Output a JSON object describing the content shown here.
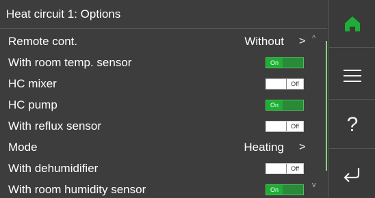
{
  "header": {
    "title": "Heat circuit 1: Options"
  },
  "rows": [
    {
      "label": "Remote cont.",
      "type": "select",
      "value": "Without"
    },
    {
      "label": "With room temp. sensor",
      "type": "toggle",
      "state": "On"
    },
    {
      "label": "HC mixer",
      "type": "toggle",
      "state": "Off"
    },
    {
      "label": "HC pump",
      "type": "toggle",
      "state": "On"
    },
    {
      "label": "With reflux sensor",
      "type": "toggle",
      "state": "Off"
    },
    {
      "label": "Mode",
      "type": "select",
      "value": "Heating"
    },
    {
      "label": "With dehumidifier",
      "type": "toggle",
      "state": "Off"
    },
    {
      "label": "With room humidity sensor",
      "type": "toggle",
      "state": "On"
    }
  ],
  "glyphs": {
    "chevron_right": ">",
    "scroll_up": "^",
    "scroll_down": "v"
  },
  "sidebar": {
    "icons": [
      "home-icon",
      "menu-icon",
      "help-icon",
      "back-icon"
    ],
    "help_label": "?"
  },
  "colors": {
    "accent": "#1fae35",
    "background": "#3d3d3d"
  }
}
